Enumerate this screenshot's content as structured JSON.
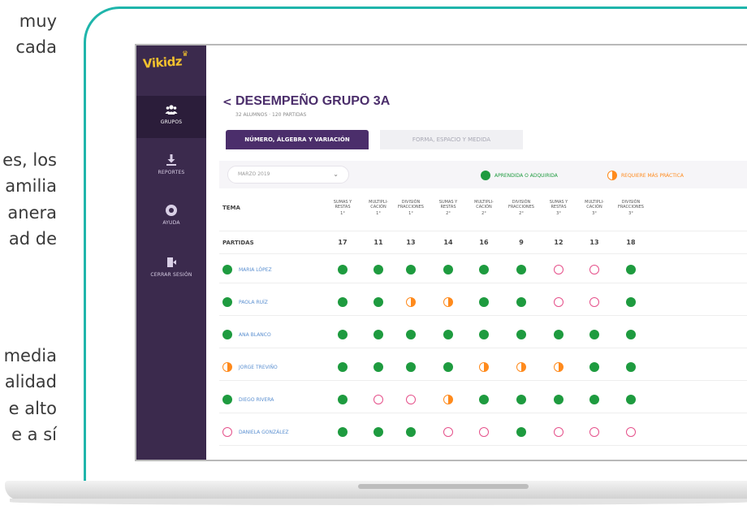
{
  "side_text": [
    "muy",
    "cada",
    "es, los",
    "amilia",
    "anera",
    "ad de",
    "media",
    "alidad",
    "e alto",
    "e a sí"
  ],
  "sidebar": {
    "logo": "Vikidz",
    "items": [
      {
        "label": "GRUPOS",
        "icon": "users-icon",
        "active": true
      },
      {
        "label": "REPORTES",
        "icon": "download-icon",
        "active": false
      },
      {
        "label": "AYUDA",
        "icon": "help-icon",
        "active": false
      },
      {
        "label": "CERRAR SESIÓN",
        "icon": "logout-icon",
        "active": false
      }
    ]
  },
  "header": {
    "back": "<",
    "title": "DESEMPEÑO GRUPO 3A",
    "subtitle": "32 ALUMNOS · 120 PARTIDAS"
  },
  "tabs": [
    {
      "label": "NÚMERO, ÁLGEBRA Y VARIACIÓN",
      "active": true
    },
    {
      "label": "FORMA, ESPACIO Y MEDIDA",
      "active": false
    }
  ],
  "filter": {
    "date": "MARZO 2019",
    "legend": [
      {
        "label": "APRENDIDA O ADQUIRIDA",
        "color": "#1e9b3f"
      },
      {
        "label": "REQUIERE MÁS PRÁCTICA",
        "color": "#ff8a1c"
      }
    ]
  },
  "table": {
    "topic_header": "TEMA",
    "columns": [
      {
        "l1": "SUMAS Y",
        "l2": "RESTAS",
        "grade": "1°"
      },
      {
        "l1": "MULTIPLI-",
        "l2": "CACIÓN",
        "grade": "1°"
      },
      {
        "l1": "DIVISIÓN",
        "l2": "FRACCIONES",
        "grade": "1°"
      },
      {
        "l1": "SUMAS Y",
        "l2": "RESTAS",
        "grade": "2°"
      },
      {
        "l1": "MULTIPLI-",
        "l2": "CACIÓN",
        "grade": "2°"
      },
      {
        "l1": "DIVISIÓN",
        "l2": "FRACCIONES",
        "grade": "2°"
      },
      {
        "l1": "SUMAS Y",
        "l2": "RESTAS",
        "grade": "3°"
      },
      {
        "l1": "MULTIPLI-",
        "l2": "CACIÓN",
        "grade": "3°"
      },
      {
        "l1": "DIVISIÓN",
        "l2": "FRACCIONES",
        "grade": "3°"
      }
    ],
    "partidas_label": "PARTIDAS",
    "partidas": [
      "17",
      "11",
      "13",
      "14",
      "16",
      "9",
      "12",
      "13",
      "18"
    ],
    "students": [
      {
        "name": "MARIA LÓPEZ",
        "status": "full",
        "cells": [
          "full",
          "full",
          "full",
          "full",
          "full",
          "full",
          "empty",
          "empty",
          "full"
        ]
      },
      {
        "name": "PAOLA RUÍZ",
        "status": "full",
        "cells": [
          "full",
          "full",
          "half",
          "half",
          "full",
          "full",
          "empty",
          "empty",
          "full"
        ]
      },
      {
        "name": "ANA BLANCO",
        "status": "full",
        "cells": [
          "full",
          "full",
          "full",
          "full",
          "full",
          "full",
          "full",
          "full",
          "full"
        ]
      },
      {
        "name": "JORGE TREVIÑO",
        "status": "half",
        "cells": [
          "full",
          "full",
          "full",
          "full",
          "half",
          "half",
          "half",
          "full",
          "full"
        ]
      },
      {
        "name": "DIEGO RIVERA",
        "status": "full",
        "cells": [
          "full",
          "empty",
          "empty",
          "half",
          "full",
          "full",
          "full",
          "full",
          "full"
        ]
      },
      {
        "name": "DANIELA GONZÁLEZ",
        "status": "empty",
        "cells": [
          "full",
          "full",
          "full",
          "empty",
          "empty",
          "full",
          "empty",
          "empty",
          "empty"
        ]
      }
    ]
  }
}
